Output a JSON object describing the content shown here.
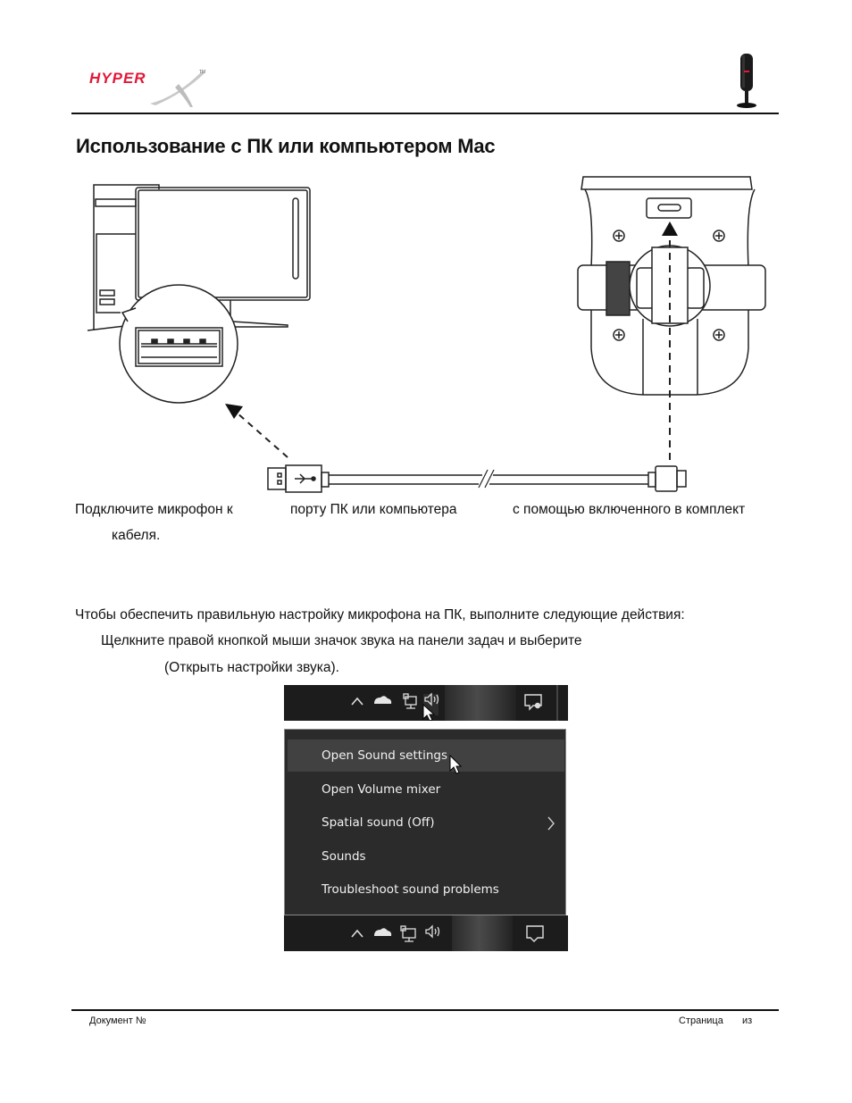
{
  "header": {
    "brand_logo": "HyperX",
    "product_icon": "microphone-icon"
  },
  "section": {
    "title": "Использование с ПК или компьютером Mac"
  },
  "instructions": {
    "connect_part1": "Подключите микрофон к",
    "connect_part2": "порту ПК или компьютера",
    "connect_part3": "с помощью включенного в комплект",
    "connect_part4": "кабеля.",
    "setup_intro": "Чтобы обеспечить правильную настройку микрофона на ПК, выполните следующие действия:",
    "step1_line1": "Щелкните правой кнопкой мыши значок звука на панели задач и выберите",
    "step1_line2": "(Открыть настройки звука)."
  },
  "context_menu": {
    "items": [
      {
        "label": "Open Sound settings",
        "highlighted": true
      },
      {
        "label": "Open Volume mixer"
      },
      {
        "label": "Spatial sound (Off)",
        "has_submenu": true
      },
      {
        "label": "Sounds"
      },
      {
        "label": "Troubleshoot sound problems"
      }
    ]
  },
  "taskbar": {
    "icons": [
      "chevron-up-icon",
      "onedrive-cloud-icon",
      "network-icon",
      "volume-icon",
      "action-center-icon"
    ]
  },
  "footer": {
    "doc_label": "Документ №",
    "page_label": "Страница",
    "of_label": "из"
  },
  "colors": {
    "brand_red": "#e31837",
    "menu_bg": "#2b2b2b",
    "menu_hover": "#414141",
    "taskbar_bg": "#1c1c1c"
  }
}
